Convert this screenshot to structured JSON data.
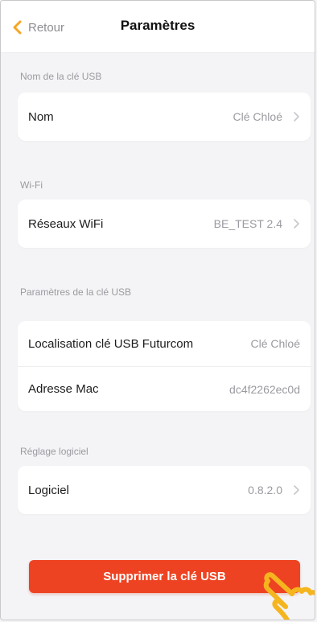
{
  "header": {
    "back_label": "Retour",
    "title": "Paramètres"
  },
  "sections": {
    "name": {
      "label": "Nom de la clé USB",
      "row_label": "Nom",
      "row_value": "Clé Chloé"
    },
    "wifi": {
      "label": "Wi-Fi",
      "row_label": "Réseaux WiFi",
      "row_value": "BE_TEST 2.4"
    },
    "usb": {
      "label": "Paramètres de la clé USB",
      "rows": [
        {
          "label": "Localisation clé USB Futurcom",
          "value": "Clé Chloé"
        },
        {
          "label": "Adresse Mac",
          "value": "dc4f2262ec0d"
        }
      ]
    },
    "software": {
      "label": "Réglage logiciel",
      "row_label": "Logiciel",
      "row_value": "0.8.2.0"
    }
  },
  "delete_button": "Supprimer la clé USB",
  "colors": {
    "accent": "#f5a623",
    "danger": "#ee4322",
    "hand": "#f5b51f"
  },
  "icons": [
    "chevron-left-icon",
    "chevron-right-icon",
    "pointing-hand-icon"
  ]
}
